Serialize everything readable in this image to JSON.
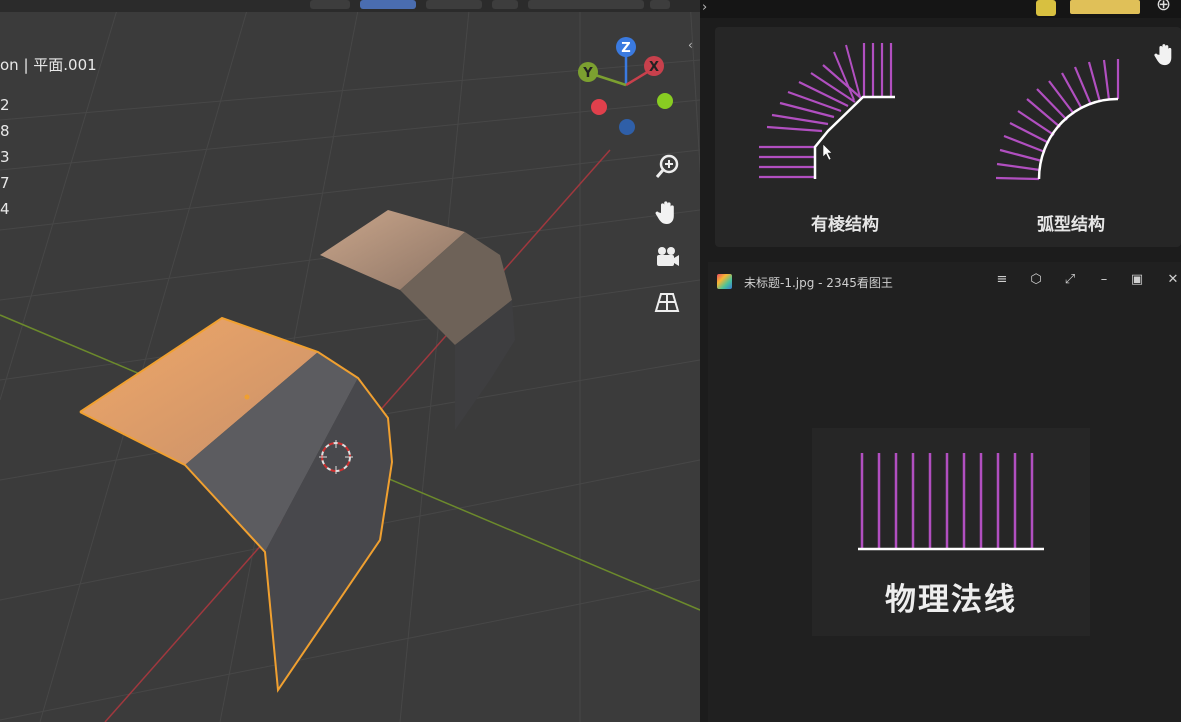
{
  "viewport": {
    "object_label": "on | 平面.001",
    "stats": [
      "2",
      "8",
      "3",
      "7",
      "4"
    ],
    "gizmo": {
      "z_label": "Z",
      "y_label": "Y",
      "x_label": "X"
    },
    "nav_tools": [
      "zoom-icon",
      "hand-icon",
      "camera-icon",
      "grid-icon"
    ],
    "colors": {
      "selection": "#f0a030",
      "axis_x": "#c8404c",
      "axis_y": "#7ca030",
      "axis_z": "#3a7ae0"
    }
  },
  "right_panel": {
    "caption_left": "有棱结构",
    "caption_right": "弧型结构",
    "normal_color": "#b14fc0"
  },
  "viewer": {
    "title": "未标题-1.jpg - 2345看图王",
    "image_caption": "物理法线",
    "controls": [
      "menu-icon",
      "shirt-icon",
      "fullscreen-icon",
      "minimize-icon",
      "maximize-icon",
      "close-icon"
    ]
  }
}
